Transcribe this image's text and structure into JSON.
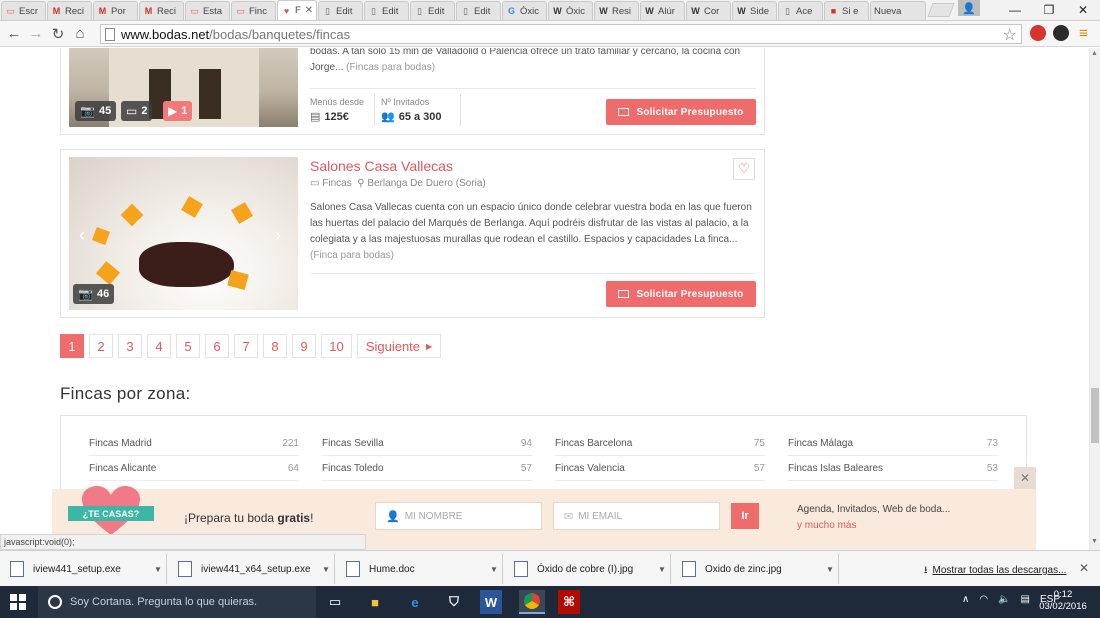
{
  "browser": {
    "tabs": [
      {
        "title": "Escr",
        "favicon": "doc-icon",
        "color": "#e45a5a"
      },
      {
        "title": "Reci",
        "favicon": "gmail-icon",
        "color": "#d93025"
      },
      {
        "title": "Por",
        "favicon": "gmail-icon",
        "color": "#d93025"
      },
      {
        "title": "Reci",
        "favicon": "gmail-icon",
        "color": "#d93025"
      },
      {
        "title": "Esta",
        "favicon": "doc-icon",
        "color": "#e45a5a"
      },
      {
        "title": "Finc",
        "favicon": "doc-icon",
        "color": "#e45a5a"
      },
      {
        "title": "F",
        "favicon": "heart-icon",
        "color": "#e45a5a",
        "active": true
      },
      {
        "title": "Edit",
        "favicon": "page-icon",
        "color": "#666"
      },
      {
        "title": "Edit",
        "favicon": "page-icon",
        "color": "#666"
      },
      {
        "title": "Edit",
        "favicon": "page-icon",
        "color": "#666"
      },
      {
        "title": "Edit",
        "favicon": "page-icon",
        "color": "#666"
      },
      {
        "title": "Óxic",
        "favicon": "google-icon",
        "color": "#4285f4"
      },
      {
        "title": "Óxic",
        "favicon": "wikipedia-icon",
        "color": "#333"
      },
      {
        "title": "Resi",
        "favicon": "wikipedia-icon",
        "color": "#333"
      },
      {
        "title": "Alúr",
        "favicon": "wikipedia-icon",
        "color": "#333"
      },
      {
        "title": "Cor",
        "favicon": "wikipedia-icon",
        "color": "#333"
      },
      {
        "title": "Side",
        "favicon": "wikipedia-icon",
        "color": "#333"
      },
      {
        "title": "Ace",
        "favicon": "page-icon",
        "color": "#666"
      },
      {
        "title": "Si e",
        "favicon": "site-icon",
        "color": "#d93025"
      },
      {
        "title": "Nueva",
        "favicon": "none",
        "color": "#666"
      }
    ],
    "url_host": "www.bodas.net",
    "url_path": "/bodas/banquetes/fincas",
    "window_controls": {
      "minimize": "—",
      "restore": "❐",
      "close": "✕"
    }
  },
  "listing1": {
    "desc": "bodas. A tan sólo 15 min de Valladolid o Palencia ofrece un trato familiar y cercano, la cocina con Jorge...",
    "more": "(Fincas para bodas)",
    "photos": "45",
    "videos": "2",
    "tours": "1",
    "menu_label": "Menús desde",
    "menu_value": "125€",
    "guests_label": "Nº Invitados",
    "guests_value": "65 a 300",
    "cta": "Solicitar Presupuesto"
  },
  "listing2": {
    "name": "Salones Casa Vallecas",
    "category": "Fincas",
    "location": "Berlanga De Duero (Soria)",
    "desc": "Salones Casa Vallecas cuenta con un espacio único donde celebrar vuestra boda en las que fueron las huertas del palacio del Marqués de Berlanga. Aquí podréis disfrutar de las vistas al palacio, a la colegiata y a las majestuosas murallas que rodean el castillo. Espacios y capacidades La finca...",
    "more": "(Finca para bodas)",
    "photos": "46",
    "cta": "Solicitar Presupuesto"
  },
  "pagination": {
    "pages": [
      "1",
      "2",
      "3",
      "4",
      "5",
      "6",
      "7",
      "8",
      "9",
      "10"
    ],
    "current": "1",
    "next": "Siguiente"
  },
  "zones": {
    "title": "Fincas por zona:",
    "items": [
      {
        "name": "Fincas Madrid",
        "count": "221"
      },
      {
        "name": "Fincas Sevilla",
        "count": "94"
      },
      {
        "name": "Fincas Barcelona",
        "count": "75"
      },
      {
        "name": "Fincas Málaga",
        "count": "73"
      },
      {
        "name": "Fincas Alicante",
        "count": "64"
      },
      {
        "name": "Fincas Toledo",
        "count": "57"
      },
      {
        "name": "Fincas Valencia",
        "count": "57"
      },
      {
        "name": "Fincas Islas Baleares",
        "count": "53"
      }
    ]
  },
  "newsletter": {
    "badge": "¿TE CASAS?",
    "text_prefix": "¡Prepara tu boda ",
    "text_bold": "gratis",
    "text_suffix": "!",
    "name_placeholder": "MI NOMBRE",
    "email_placeholder": "MI EMAIL",
    "submit": "Ir",
    "right_text": "Agenda, Invitados, Web de boda...",
    "right_link": "y mucho más",
    "close": "✕"
  },
  "status_bar": "javascript:void(0);",
  "downloads": {
    "items": [
      {
        "name": "iview441_setup.exe",
        "icon": "exe-icon"
      },
      {
        "name": "iview441_x64_setup.exe",
        "icon": "exe-icon"
      },
      {
        "name": "Hume.doc",
        "icon": "word-doc-icon"
      },
      {
        "name": "Óxido de cobre (I).jpg",
        "icon": "image-file-icon"
      },
      {
        "name": "Oxido de zinc.jpg",
        "icon": "image-file-icon"
      }
    ],
    "show_all": "Mostrar todas las descargas...",
    "close": "✕"
  },
  "taskbar": {
    "cortana": "Soy Cortana. Pregunta lo que quieras.",
    "language": "ESP",
    "time": "0:12",
    "date": "03/02/2016"
  },
  "colors": {
    "accent": "#f06b6b",
    "accent_text": "#e25858",
    "newsletter_bg": "#faeade",
    "badge_teal": "#3cb6a5",
    "taskbar": "#1e2a39"
  }
}
